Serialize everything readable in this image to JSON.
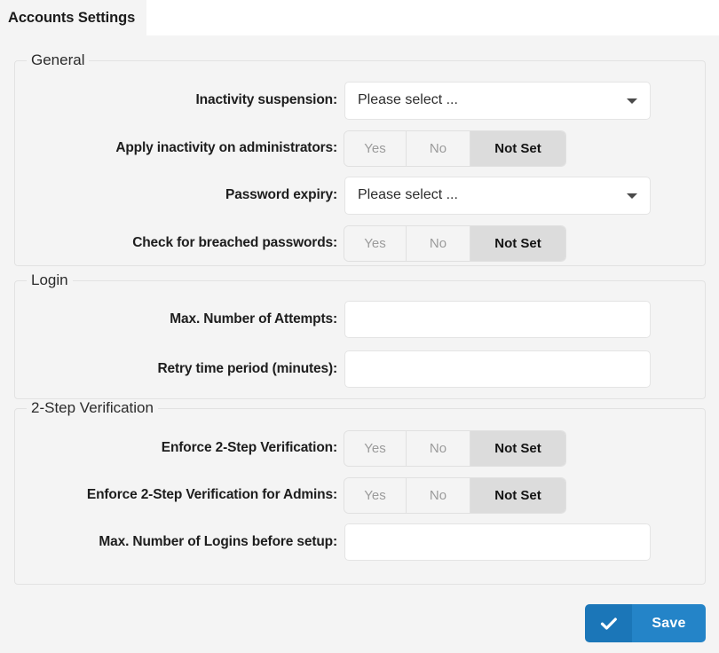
{
  "tab": {
    "active_label": "Accounts Settings"
  },
  "sections": {
    "general": {
      "legend": "General",
      "rows": [
        {
          "label": "Inactivity suspension:",
          "type": "select",
          "value": "Please select ..."
        },
        {
          "label": "Apply inactivity on administrators:",
          "type": "tristate",
          "selected": "Not Set"
        },
        {
          "label": "Password expiry:",
          "type": "select",
          "value": "Please select ..."
        },
        {
          "label": "Check for breached passwords:",
          "type": "tristate",
          "selected": "Not Set"
        }
      ]
    },
    "login": {
      "legend": "Login",
      "rows": [
        {
          "label": "Max. Number of Attempts:",
          "type": "text",
          "value": "",
          "placeholder": ""
        },
        {
          "label": "Retry time period (minutes):",
          "type": "text",
          "value": "",
          "placeholder": ""
        }
      ]
    },
    "twostep": {
      "legend": "2-Step Verification",
      "rows": [
        {
          "label": "Enforce 2-Step Verification:",
          "type": "tristate",
          "selected": "Not Set"
        },
        {
          "label": "Enforce 2-Step Verification for Admins:",
          "type": "tristate",
          "selected": "Not Set"
        },
        {
          "label": "Max. Number of Logins before setup:",
          "type": "text",
          "value": "",
          "placeholder": ""
        }
      ]
    }
  },
  "tristate_options": {
    "yes": "Yes",
    "no": "No",
    "not_set": "Not Set"
  },
  "footer": {
    "save_label": "Save",
    "save_icon": "check-icon"
  },
  "colors": {
    "page_background": "#f4f4f4",
    "accent_blue": "#2484c8",
    "accent_blue_dark": "#1b76b8",
    "field_border": "#e4e4e4",
    "fieldset_border": "#e2e2e2",
    "segment_selected_bg": "#dcdcdc",
    "segment_idle_text": "#9b9b9b"
  }
}
